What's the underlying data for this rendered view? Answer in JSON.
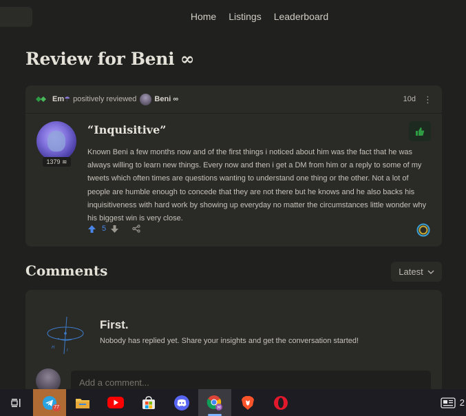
{
  "nav": {
    "items": [
      "Home",
      "Listings",
      "Leaderboard"
    ]
  },
  "page": {
    "title": "Review for Beni ∞"
  },
  "review": {
    "reviewer": "Em",
    "reviewer_emoji": "☂",
    "action_text": "positively reviewed",
    "reviewee": "Beni ∞",
    "time_ago": "10d",
    "menu_glyph": "⋮",
    "score": "1379 ≋",
    "title": "“Inquisitive”",
    "body": "Known Beni a few months now and of the first things i noticed about him was the fact that he was always willing to learn new things. Every now and then i get a DM from him or a reply to some of my tweets which often times are questions wanting to understand one thing or the other. Not a lot of people are humble enough to concede that they are not there but he knows and he also backs his inquisitiveness with hard work by showing up everyday no matter the circumstances little wonder why his biggest win is very close.",
    "upvotes": "5",
    "sentiment": "positive",
    "colors": {
      "positive": "#2e9c42",
      "upvote": "#4a86e8",
      "ring_outer": "#3aa0d8",
      "ring_inner": "#c9a834"
    }
  },
  "comments": {
    "title": "Comments",
    "sort_label": "Latest",
    "empty_title": "First.",
    "empty_subtitle": "Nobody has replied yet. Share your insights and get the conversation started!",
    "input_placeholder": "Add a comment..."
  },
  "taskbar": {
    "apps": [
      "task-view",
      "telegram",
      "file-explorer",
      "youtube",
      "microsoft-store",
      "discord",
      "chrome",
      "brave",
      "opera"
    ],
    "telegram_badge": "77",
    "clock_partial": "2"
  }
}
